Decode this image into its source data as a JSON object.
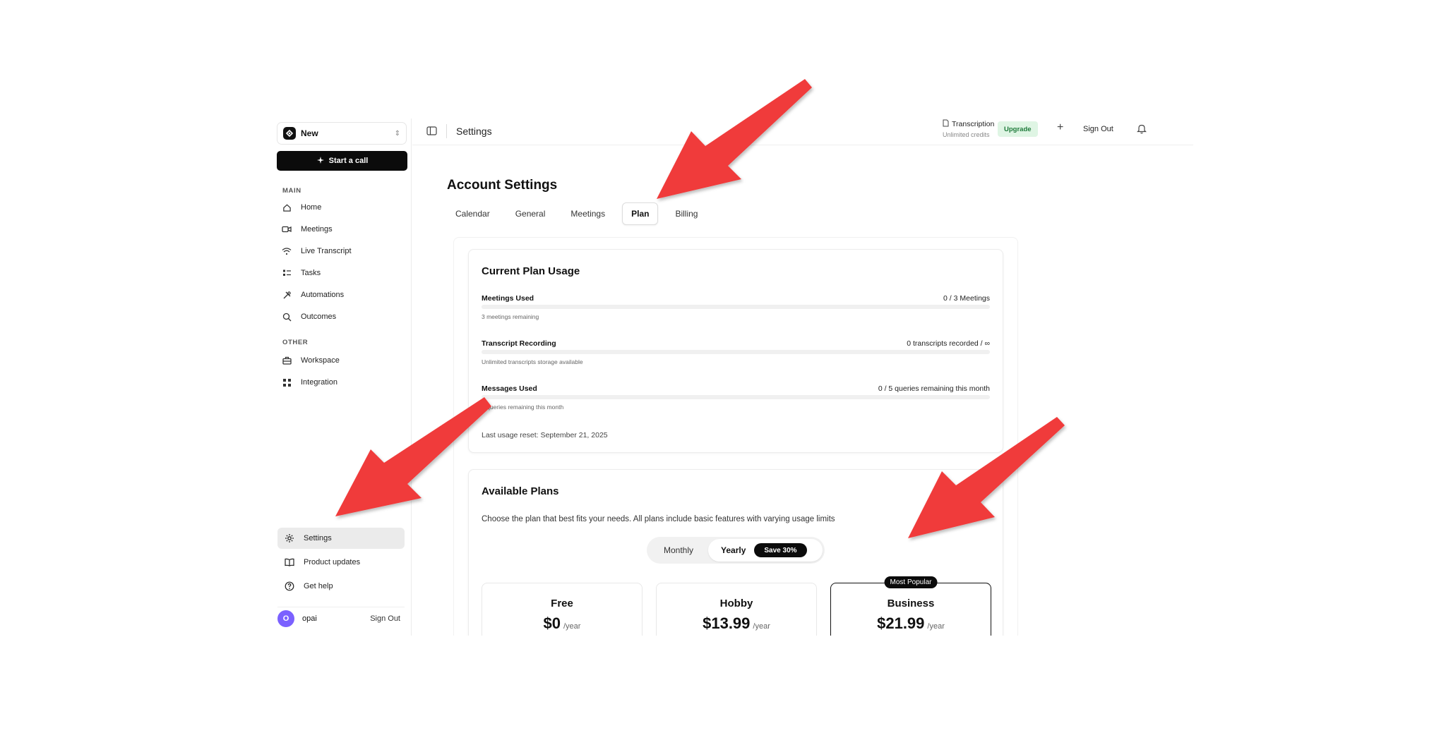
{
  "sidebar": {
    "workspace_name": "New",
    "start_call_label": "Start a call",
    "main_heading": "MAIN",
    "main_items": [
      {
        "label": "Home",
        "icon": "home-icon"
      },
      {
        "label": "Meetings",
        "icon": "video-icon"
      },
      {
        "label": "Live Transcript",
        "icon": "wifi-icon"
      },
      {
        "label": "Tasks",
        "icon": "tasks-icon"
      },
      {
        "label": "Automations",
        "icon": "tools-icon"
      },
      {
        "label": "Outcomes",
        "icon": "search-icon"
      }
    ],
    "other_heading": "OTHER",
    "other_items": [
      {
        "label": "Workspace",
        "icon": "briefcase-icon"
      },
      {
        "label": "Integration",
        "icon": "integration-icon"
      }
    ],
    "bottom_items": [
      {
        "label": "Settings",
        "icon": "gear-icon",
        "active": true
      },
      {
        "label": "Product updates",
        "icon": "book-icon"
      },
      {
        "label": "Get help",
        "icon": "help-icon"
      }
    ],
    "user": {
      "initial": "O",
      "name": "opai",
      "sign_out": "Sign Out"
    }
  },
  "topbar": {
    "title": "Settings",
    "transcription_label": "Transcription",
    "transcription_sub": "Unlimited credits",
    "upgrade_label": "Upgrade",
    "plus": "+",
    "sign_out": "Sign Out"
  },
  "page": {
    "heading": "Account Settings",
    "tabs": [
      {
        "label": "Calendar",
        "active": false
      },
      {
        "label": "General",
        "active": false
      },
      {
        "label": "Meetings",
        "active": false
      },
      {
        "label": "Plan",
        "active": true
      },
      {
        "label": "Billing",
        "active": false
      }
    ]
  },
  "usage": {
    "title": "Current Plan Usage",
    "rows": [
      {
        "label": "Meetings Used",
        "value": "0 / 3 Meetings",
        "sub": "3 meetings remaining",
        "progress": 0
      },
      {
        "label": "Transcript Recording",
        "value": "0 transcripts recorded / ∞",
        "sub": "Unlimited transcripts storage available",
        "progress": 0
      },
      {
        "label": "Messages Used",
        "value": "0 / 5 queries remaining this month",
        "sub": "5 queries remaining this month",
        "progress": 0
      }
    ],
    "last_reset": "Last usage reset: September 21, 2025"
  },
  "plans": {
    "title": "Available Plans",
    "description": "Choose the plan that best fits your needs. All plans include basic features with varying usage limits",
    "toggle": {
      "monthly": "Monthly",
      "yearly": "Yearly",
      "save": "Save 30%",
      "selected": "Yearly"
    },
    "items": [
      {
        "name": "Free",
        "price": "$0",
        "per": "/year",
        "popular": false
      },
      {
        "name": "Hobby",
        "price": "$13.99",
        "per": "/year",
        "popular": false
      },
      {
        "name": "Business",
        "price": "$21.99",
        "per": "/year",
        "popular": true,
        "badge": "Most Popular"
      }
    ]
  },
  "colors": {
    "accent": "#0b0b0b",
    "arrow": "#f03a3a",
    "upgrade_bg": "#dff5e4",
    "avatar": "#7b61ff"
  }
}
